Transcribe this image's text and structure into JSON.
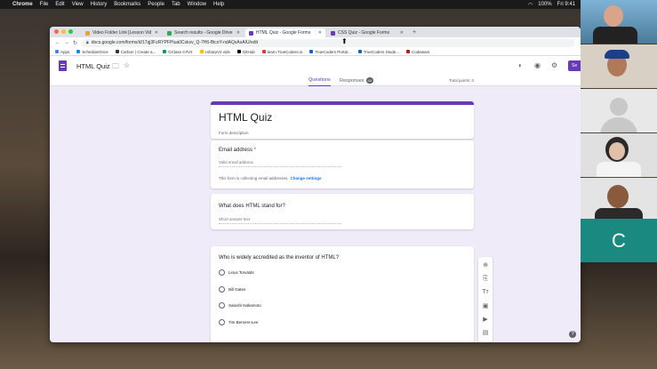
{
  "menubar": {
    "app": "Chrome",
    "items": [
      "File",
      "Edit",
      "View",
      "History",
      "Bookmarks",
      "People",
      "Tab",
      "Window",
      "Help"
    ],
    "battery": "100%",
    "clock": "Fri 9:41"
  },
  "browser": {
    "tabs": [
      {
        "label": "Video Folder Link [Lesson Vid",
        "color": "#e8a23a"
      },
      {
        "label": "Search results - Google Drive",
        "color": "#34a853"
      },
      {
        "label": "HTML Quiz - Google Forms",
        "color": "#673ab7"
      },
      {
        "label": "CSS Quiz - Google Forms",
        "color": "#673ab7"
      }
    ],
    "url": "docs.google.com/forms/d/17qj3FzRYPFPtua0Cxkxv_Q-7H6-BicoY-ndAQxAsAIU/edit",
    "bookmarks": [
      {
        "label": "Apps",
        "color": "#4285f4"
      },
      {
        "label": "ScheduleOnce",
        "color": "#1e88e5"
      },
      {
        "label": "Carbon | Create a...",
        "color": "#333333"
      },
      {
        "label": "GClass C#V2",
        "color": "#0f9d58"
      },
      {
        "label": "csharpV2 vids",
        "color": "#fbbc04"
      },
      {
        "label": "GitHub",
        "color": "#000000"
      },
      {
        "label": "learn.TrueCoders.io",
        "color": "#e53935"
      },
      {
        "label": "TrueCoders Portal...",
        "color": "#1565c0"
      },
      {
        "label": "TrueCoders Stude...",
        "color": "#1565c0"
      },
      {
        "label": "Codewars",
        "color": "#b71c1c"
      }
    ]
  },
  "forms": {
    "doc_title": "HTML Quiz",
    "send_label": "Se",
    "tabs": {
      "questions": "Questions",
      "responses": "Responses",
      "responses_count": "44"
    },
    "total_points": "Total points: 0",
    "title": "HTML Quiz",
    "description": "Form description",
    "email": {
      "label": "Email address",
      "required_mark": "*",
      "placeholder": "Valid email address",
      "collect_note": "This form is collecting email addresses.",
      "change_link": "Change settings"
    },
    "q1": {
      "label": "What does HTML stand for?",
      "placeholder": "Short answer text"
    },
    "q2": {
      "label": "Who is widely accredited as the inventor of HTML?",
      "options": [
        "Linus Torvalds",
        "Bill Gates",
        "Satoshi Nakamoto",
        "Tim Berners-Lee"
      ]
    }
  },
  "participant_c": "C",
  "colors": {
    "accent": "#673ab7",
    "bg": "#f0ebf8"
  }
}
